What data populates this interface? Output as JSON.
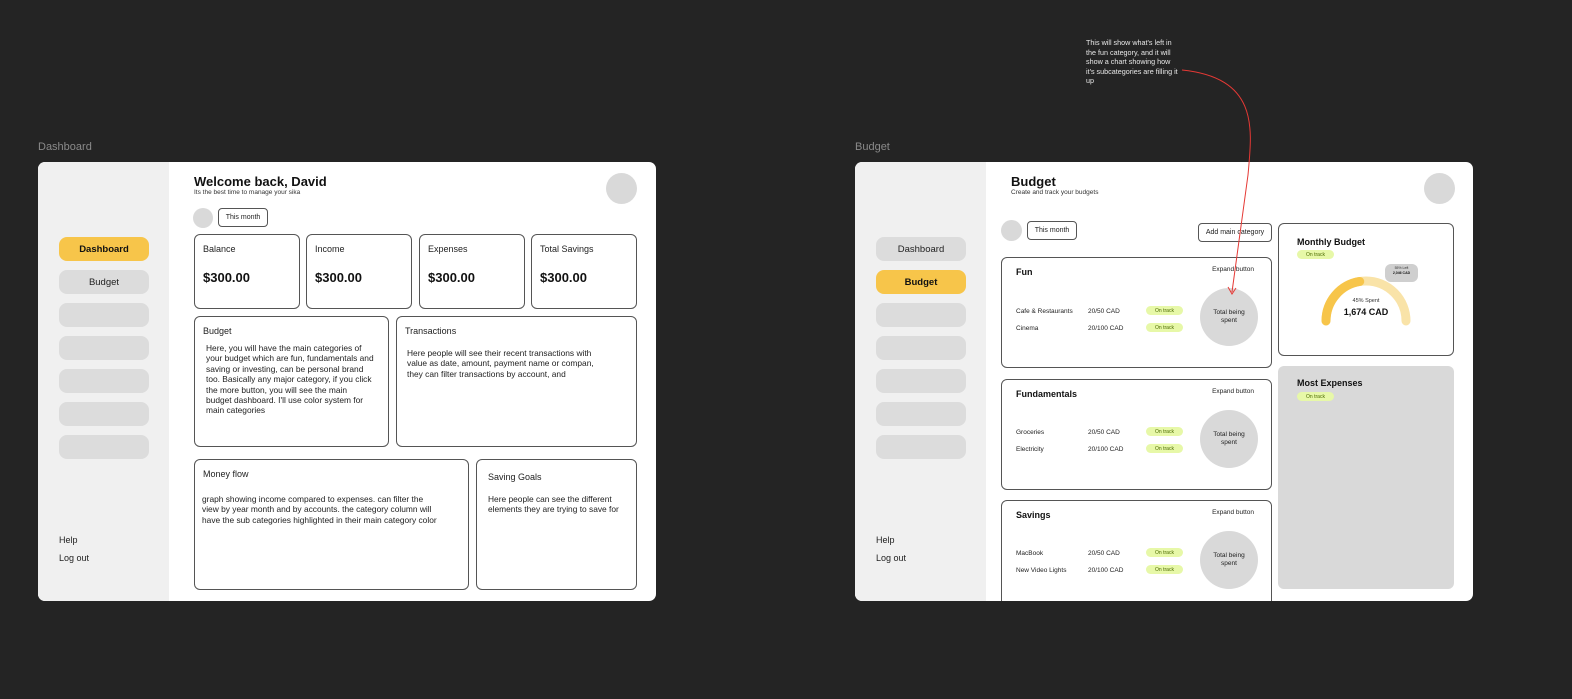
{
  "dashboard": {
    "frame_label": "Dashboard",
    "nav": {
      "items": [
        "Dashboard",
        "Budget",
        "",
        "",
        "",
        "",
        ""
      ],
      "active": "Dashboard",
      "help": "Help",
      "logout": "Log out"
    },
    "header": {
      "title": "Welcome back, David",
      "subtitle": "Its the best time to manage your sika"
    },
    "filter_label": "This month",
    "stats": [
      {
        "label": "Balance",
        "amount": "$300.00"
      },
      {
        "label": "Income",
        "amount": "$300.00"
      },
      {
        "label": "Expenses",
        "amount": "$300.00"
      },
      {
        "label": "Total Savings",
        "amount": "$300.00"
      }
    ],
    "budget_card": {
      "title": "Budget",
      "body": "Here, you will have the main categories of your budget which are fun, fundamentals and saving or investing, can be personal brand too. Basically any major category, if you click the more button, you will see the main budget dashboard. I'll use color system for main categories"
    },
    "transactions_card": {
      "title": "Transactions",
      "body": "Here people will see their recent transactions with value as date, amount, payment name or compan, they can filter transactions by account, and"
    },
    "money_flow_card": {
      "title": "Money flow",
      "body": "graph showing income compared to expenses. can filter the view by year month and by accounts. the category column will have the sub categories highlighted in their main category color"
    },
    "saving_goals_card": {
      "title": "Saving Goals",
      "body": "Here people can see the different elements they are trying to save for"
    }
  },
  "budget": {
    "frame_label": "Budget",
    "nav": {
      "items": [
        "Dashboard",
        "Budget",
        "",
        "",
        "",
        "",
        ""
      ],
      "active": "Budget",
      "help": "Help",
      "logout": "Log out"
    },
    "header": {
      "title": "Budget",
      "subtitle": "Create and track your budgets"
    },
    "filter_label": "This month",
    "add_button": "Add main category",
    "categories": [
      {
        "title": "Fun",
        "expand": "Expand button",
        "rows": [
          {
            "name": "Cafe & Restaurants",
            "value": "20/50 CAD",
            "status": "On track"
          },
          {
            "name": "Cinema",
            "value": "20/100 CAD",
            "status": "On track"
          }
        ],
        "ring": "Total being spent"
      },
      {
        "title": "Fundamentals",
        "expand": "Expand button",
        "rows": [
          {
            "name": "Groceries",
            "value": "20/50 CAD",
            "status": "On track"
          },
          {
            "name": "Electricity",
            "value": "20/100 CAD",
            "status": "On track"
          }
        ],
        "ring": "Total being spent"
      },
      {
        "title": "Savings",
        "expand": "Expand button",
        "rows": [
          {
            "name": "MacBook",
            "value": "20/50 CAD",
            "status": "On track"
          },
          {
            "name": "New Video Lights",
            "value": "20/100 CAD",
            "status": "On track"
          }
        ],
        "ring": "Total being spent"
      }
    ],
    "monthly_budget": {
      "title": "Monthly Budget",
      "status": "On track",
      "spent_label": "45% Spent",
      "amount": "1,674 CAD",
      "left_label": "55% Left",
      "left_amount": "2,046 CAD",
      "spent_fraction": 0.45,
      "colors": {
        "spent": "#f7c54a",
        "remaining": "#f9e3a8"
      }
    },
    "most_expenses": {
      "title": "Most Expenses",
      "status": "On track"
    }
  },
  "annotation": {
    "text": "This will show what's left in the fun category, and it will show a chart showing how it's subcategories are filling it up",
    "color": "#e53935"
  },
  "colors": {
    "background": "#242424",
    "accent": "#f7c54a",
    "badge_bg": "#e7f8a8",
    "sidebar": "#f0f0f0"
  }
}
